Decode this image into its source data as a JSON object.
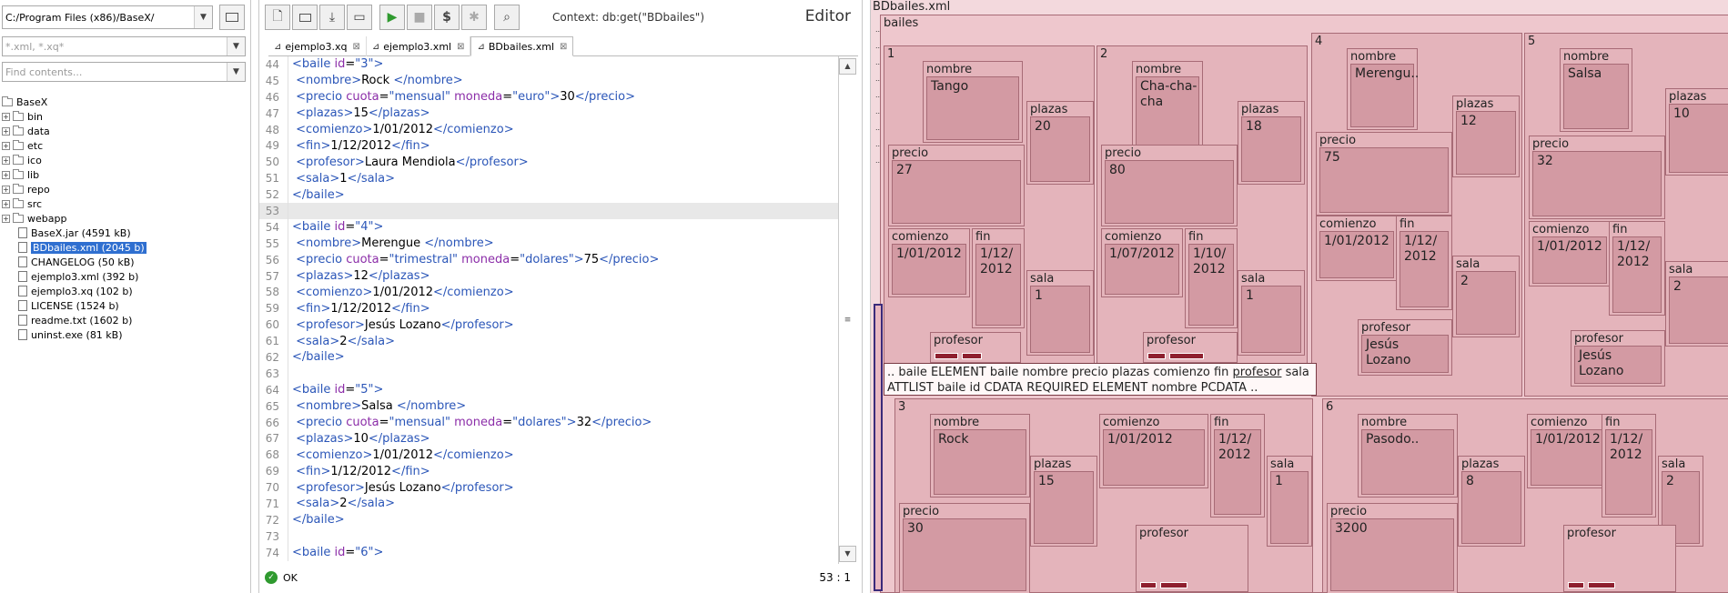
{
  "left": {
    "path": "C:/Program Files (x86)/BaseX/",
    "filter_placeholder": "*.xml, *.xq*",
    "contents_placeholder": "Find contents...",
    "tree": [
      {
        "label": "BaseX",
        "type": "root"
      },
      {
        "label": "bin",
        "type": "folder"
      },
      {
        "label": "data",
        "type": "folder"
      },
      {
        "label": "etc",
        "type": "folder"
      },
      {
        "label": "ico",
        "type": "folder"
      },
      {
        "label": "lib",
        "type": "folder"
      },
      {
        "label": "repo",
        "type": "folder"
      },
      {
        "label": "src",
        "type": "folder"
      },
      {
        "label": "webapp",
        "type": "folder"
      },
      {
        "label": "BaseX.jar (4591 kB)",
        "type": "file"
      },
      {
        "label": "BDbailes.xml (2045 b)",
        "type": "file",
        "selected": true
      },
      {
        "label": "CHANGELOG (50 kB)",
        "type": "file"
      },
      {
        "label": "ejemplo3.xml (392 b)",
        "type": "file"
      },
      {
        "label": "ejemplo3.xq (102 b)",
        "type": "file"
      },
      {
        "label": "LICENSE (1524 b)",
        "type": "file"
      },
      {
        "label": "readme.txt (1602 b)",
        "type": "file"
      },
      {
        "label": "uninst.exe (81 kB)",
        "type": "file"
      }
    ]
  },
  "editor": {
    "title": "Editor",
    "context": "Context: db:get(\"BDbailes\")",
    "tabs": [
      {
        "label": "ejemplo3.xq"
      },
      {
        "label": "ejemplo3.xml"
      },
      {
        "label": "BDbailes.xml",
        "active": true
      }
    ],
    "status": "OK",
    "position": "53 : 1",
    "lines": [
      {
        "n": "44",
        "text": "<baile id=\"3\">"
      },
      {
        "n": "45",
        "text": " <nombre>Rock </nombre>"
      },
      {
        "n": "46",
        "text": " <precio cuota=\"mensual\" moneda=\"euro\">30</precio>"
      },
      {
        "n": "47",
        "text": " <plazas>15</plazas>"
      },
      {
        "n": "48",
        "text": " <comienzo>1/01/2012</comienzo>"
      },
      {
        "n": "49",
        "text": " <fin>1/12/2012</fin>"
      },
      {
        "n": "50",
        "text": " <profesor>Laura Mendiola</profesor>"
      },
      {
        "n": "51",
        "text": " <sala>1</sala>"
      },
      {
        "n": "52",
        "text": "</baile>"
      },
      {
        "n": "53",
        "text": ""
      },
      {
        "n": "54",
        "text": "<baile id=\"4\">"
      },
      {
        "n": "55",
        "text": " <nombre>Merengue </nombre>"
      },
      {
        "n": "56",
        "text": " <precio cuota=\"trimestral\" moneda=\"dolares\">75</precio>"
      },
      {
        "n": "57",
        "text": " <plazas>12</plazas>"
      },
      {
        "n": "58",
        "text": " <comienzo>1/01/2012</comienzo>"
      },
      {
        "n": "59",
        "text": " <fin>1/12/2012</fin>"
      },
      {
        "n": "60",
        "text": " <profesor>Jesús Lozano</profesor>"
      },
      {
        "n": "61",
        "text": " <sala>2</sala>"
      },
      {
        "n": "62",
        "text": "</baile>"
      },
      {
        "n": "63",
        "text": ""
      },
      {
        "n": "64",
        "text": "<baile id=\"5\">"
      },
      {
        "n": "65",
        "text": " <nombre>Salsa </nombre>"
      },
      {
        "n": "66",
        "text": " <precio cuota=\"mensual\" moneda=\"dolares\">32</precio>"
      },
      {
        "n": "67",
        "text": " <plazas>10</plazas>"
      },
      {
        "n": "68",
        "text": " <comienzo>1/01/2012</comienzo>"
      },
      {
        "n": "69",
        "text": " <fin>1/12/2012</fin>"
      },
      {
        "n": "70",
        "text": " <profesor>Jesús Lozano</profesor>"
      },
      {
        "n": "71",
        "text": " <sala>2</sala>"
      },
      {
        "n": "72",
        "text": "</baile>"
      },
      {
        "n": "73",
        "text": ""
      },
      {
        "n": "74",
        "text": "<baile id=\"6\">"
      }
    ]
  },
  "map": {
    "title": "BDbailes.xml",
    "root": "bailes",
    "tooltip_line1_before": ".. baile ELEMENT baile nombre precio plazas comienzo fin ",
    "tooltip_line1_underlined": "profesor",
    "tooltip_line1_after": " sala",
    "tooltip_line2": "ATTLIST baile id CDATA REQUIRED ELEMENT nombre PCDATA ..",
    "bailes": [
      {
        "id": "1",
        "nombre": "Tango",
        "precio": "27",
        "plazas": "20",
        "comienzo": "1/01/2012",
        "fin": "1/12/\n2012",
        "sala": "1",
        "profesor": ""
      },
      {
        "id": "2",
        "nombre": "Cha-cha-\ncha",
        "precio": "80",
        "plazas": "18",
        "comienzo": "1/07/2012",
        "fin": "1/10/\n2012",
        "sala": "1",
        "profesor": ""
      },
      {
        "id": "4",
        "nombre": "Merengu..",
        "precio": "75",
        "plazas": "12",
        "comienzo": "1/01/2012",
        "fin": "1/12/\n2012",
        "sala": "2",
        "profesor": "Jesús Lozano"
      },
      {
        "id": "5",
        "nombre": "Salsa",
        "precio": "32",
        "plazas": "10",
        "comienzo": "1/01/2012",
        "fin": "1/12/\n2012",
        "sala": "2",
        "profesor": "Jesús Lozano"
      },
      {
        "id": "3",
        "nombre": "Rock",
        "precio": "30",
        "plazas": "15",
        "comienzo": "1/01/2012",
        "fin": "1/12/\n2012",
        "sala": "1",
        "profesor": ""
      },
      {
        "id": "6",
        "nombre": "Pasodo..",
        "precio": "3200",
        "plazas": "8",
        "comienzo": "1/01/2012",
        "fin": "1/12/\n2012",
        "sala": "2",
        "profesor": ""
      }
    ],
    "labels": {
      "nombre": "nombre",
      "precio": "precio",
      "plazas": "plazas",
      "comienzo": "comienzo",
      "fin": "fin",
      "sala": "sala",
      "profesor": "profesor"
    }
  }
}
